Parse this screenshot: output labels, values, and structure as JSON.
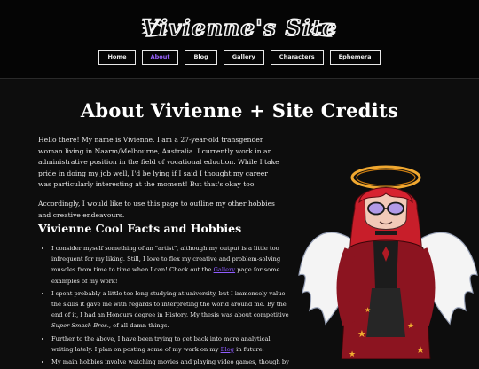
{
  "site": {
    "logo": "Vivienne's Site"
  },
  "nav": [
    {
      "label": "Home"
    },
    {
      "label": "About"
    },
    {
      "label": "Blog"
    },
    {
      "label": "Gallery"
    },
    {
      "label": "Characters"
    },
    {
      "label": "Ephemera"
    }
  ],
  "page": {
    "title": "About Vivienne + Site Credits",
    "intro_1": "Hello there! My name is Vivienne. I am a 27-year-old transgender woman living in Naarm/Melbourne, Australia. I currently work in an administrative position in the field of vocational eduction. While I take pride in doing my job well, I'd be lying if I said I thought my career was particularly interesting at the moment! But that's okay too.",
    "intro_2": "Accordingly, I would like to use this page to outline my other hobbies and creative endeavours.",
    "facts_heading": "Vivienne Cool Facts and Hobbies",
    "fact_1a": "I consider myself something of an \"artist\", although my output is a little too infrequent for my liking. Still, I love to flex my creative and problem-solving muscles from time to time when I can! Check out the ",
    "fact_1_link": "Gallery",
    "fact_1b": " page for some examples of my work!",
    "fact_2a": "I spent probably a little too long studying at university, but I immensely value the skills it gave me with regards to interpreting the world around me. By the end of it, I had an Honours degree in History. My thesis was about competitive ",
    "fact_2_em": "Super Smash Bros.",
    "fact_2b": ", of all damn things.",
    "fact_3a": "Further to the above, I have been trying to get back into more analytical writing lately. I plan on posting some of my work on my ",
    "fact_3_link": "Blog",
    "fact_3b": " in future.",
    "fact_4": "My main hobbies involve watching movies and playing video games, though by"
  },
  "colors": {
    "background": "#0d0d0d",
    "header": "#050505",
    "accent": "#9a63ff",
    "link": "#8f5cff"
  },
  "icons": [
    "wing-icon-left",
    "wing-icon-right",
    "character-illustration"
  ]
}
